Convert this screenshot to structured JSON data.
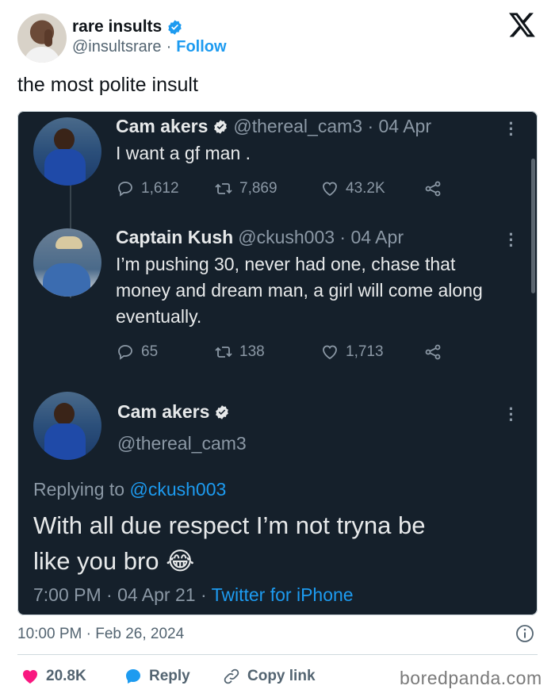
{
  "post": {
    "author_name": "rare insults",
    "handle": "@insultsrare",
    "separator": "·",
    "follow_label": "Follow",
    "text": "the most polite insult",
    "timestamp": "10:00 PM · Feb 26, 2024"
  },
  "screenshot": {
    "tweet1": {
      "name": "Cam akers",
      "handle_time": "@thereal_cam3 · 04 Apr",
      "text": "I want a gf man .",
      "replies": "1,612",
      "retweets": "7,869",
      "likes": "43.2K"
    },
    "tweet2": {
      "name": "Captain Kush",
      "handle_time": "@ckush003 · 04 Apr",
      "text_lines": [
        "I’m pushing 30, never had one, chase that",
        "money and dream man, a girl will come along",
        "eventually."
      ],
      "replies": "65",
      "retweets": "138",
      "likes": "1,713"
    },
    "tweet3": {
      "name": "Cam akers",
      "handle": "@thereal_cam3",
      "replying_prefix": "Replying to",
      "replying_to": "@ckush003",
      "text_line1": "With all due respect I’m not tryna be",
      "text_line2": "like you bro",
      "emoji": "😂",
      "time_date": "7:00 PM · 04 Apr 21 ·",
      "client": "Twitter for iPhone"
    }
  },
  "footer": {
    "likes": "20.8K",
    "reply_label": "Reply",
    "copy_link_label": "Copy link",
    "watermark": "boredpanda.com"
  },
  "colors": {
    "accent": "#1d9bf0",
    "like_red": "#f91880",
    "dark_bg": "#15202b"
  },
  "icons": [
    "verified-badge-icon",
    "x-logo-icon",
    "reply-icon",
    "retweet-icon",
    "like-icon",
    "share-icon",
    "more-icon",
    "info-icon",
    "heart-icon",
    "copy-link-icon"
  ]
}
